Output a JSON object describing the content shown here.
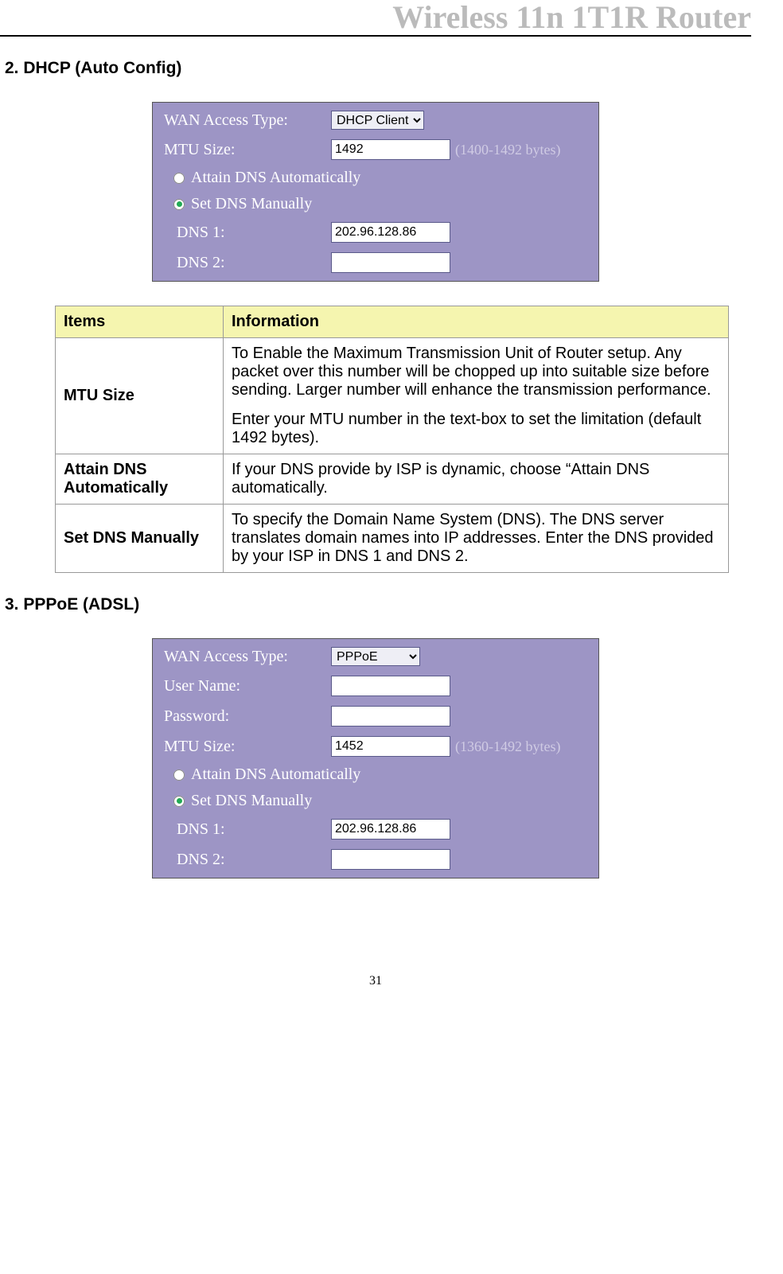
{
  "header": {
    "title": "Wireless 11n 1T1R Router"
  },
  "section2": {
    "heading": "2. DHCP (Auto Config)",
    "panel": {
      "wan_label": "WAN Access Type:",
      "wan_value": "DHCP Client",
      "mtu_label": "MTU Size:",
      "mtu_value": "1492",
      "mtu_hint": "(1400-1492 bytes)",
      "radio_auto": "Attain DNS Automatically",
      "radio_manual": "Set DNS Manually",
      "dns1_label": "DNS 1:",
      "dns1_value": "202.96.128.86",
      "dns2_label": "DNS 2:",
      "dns2_value": ""
    },
    "table": {
      "col1": "Items",
      "col2": "Information",
      "rows": [
        {
          "item": "MTU Size",
          "info_p1": "To Enable the Maximum Transmission Unit of Router setup. Any packet over this number will be chopped up into suitable size before sending. Larger number will enhance the transmission performance.",
          "info_p2": "Enter your MTU number in the text-box to set the limitation (default 1492 bytes)."
        },
        {
          "item": "Attain DNS Automatically",
          "info_p1": "If your DNS provide by ISP is dynamic, choose “Attain DNS automatically."
        },
        {
          "item": "Set DNS Manually",
          "info_p1": "To specify the Domain Name System (DNS). The DNS server translates domain names into IP addresses. Enter the DNS provided by your ISP in DNS 1 and DNS 2."
        }
      ]
    }
  },
  "section3": {
    "heading": "3. PPPoE (ADSL)",
    "panel": {
      "wan_label": "WAN Access Type:",
      "wan_value": "PPPoE",
      "user_label": "User Name:",
      "user_value": "",
      "pass_label": "Password:",
      "pass_value": "",
      "mtu_label": "MTU Size:",
      "mtu_value": "1452",
      "mtu_hint": "(1360-1492 bytes)",
      "radio_auto": "Attain DNS Automatically",
      "radio_manual": "Set DNS Manually",
      "dns1_label": "DNS 1:",
      "dns1_value": "202.96.128.86",
      "dns2_label": "DNS 2:",
      "dns2_value": ""
    }
  },
  "page_number": "31"
}
